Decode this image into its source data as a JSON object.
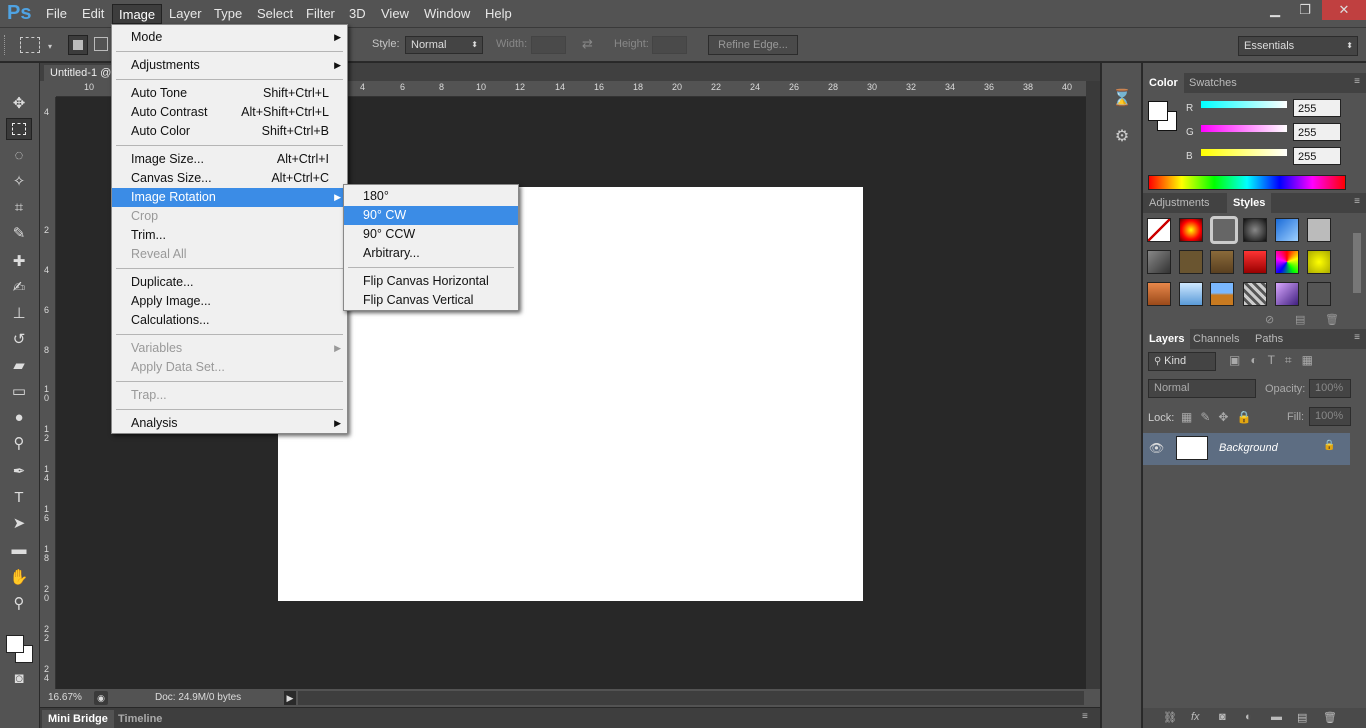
{
  "app": {
    "logo": "Ps"
  },
  "menubar": {
    "items": [
      "File",
      "Edit",
      "Image",
      "Layer",
      "Type",
      "Select",
      "Filter",
      "3D",
      "View",
      "Window",
      "Help"
    ]
  },
  "window_controls": {
    "minimize": "▁",
    "restore": "❐",
    "close": "✕"
  },
  "options_bar": {
    "style_label": "Style:",
    "style_value": "Normal",
    "width_label": "Width:",
    "height_label": "Height:",
    "refine_edge": "Refine Edge...",
    "workspace": "Essentials"
  },
  "document": {
    "tab": "Untitled-1 @",
    "zoom": "16.67%",
    "doc_info": "Doc: 24.9M/0 bytes"
  },
  "rulers": {
    "top_left": [
      "10"
    ],
    "top": [
      "4",
      "6",
      "8",
      "10",
      "12",
      "14",
      "16",
      "18",
      "20",
      "22",
      "24",
      "26",
      "28",
      "30",
      "32",
      "34",
      "36",
      "38",
      "40"
    ],
    "left": [
      "4",
      "2",
      "4",
      "6",
      "8",
      "10",
      "12",
      "14",
      "16",
      "18",
      "20",
      "22",
      "24"
    ]
  },
  "bottom_tabs": [
    "Mini Bridge",
    "Timeline"
  ],
  "image_menu": {
    "items": [
      {
        "label": "Mode",
        "arrow": true
      },
      {
        "sep": true
      },
      {
        "label": "Adjustments",
        "arrow": true
      },
      {
        "sep": true
      },
      {
        "label": "Auto Tone",
        "shortcut": "Shift+Ctrl+L"
      },
      {
        "label": "Auto Contrast",
        "shortcut": "Alt+Shift+Ctrl+L"
      },
      {
        "label": "Auto Color",
        "shortcut": "Shift+Ctrl+B"
      },
      {
        "sep": true
      },
      {
        "label": "Image Size...",
        "shortcut": "Alt+Ctrl+I"
      },
      {
        "label": "Canvas Size...",
        "shortcut": "Alt+Ctrl+C"
      },
      {
        "label": "Image Rotation",
        "arrow": true,
        "highlight": true
      },
      {
        "label": "Crop",
        "disabled": true
      },
      {
        "label": "Trim..."
      },
      {
        "label": "Reveal All",
        "disabled": true
      },
      {
        "sep": true
      },
      {
        "label": "Duplicate..."
      },
      {
        "label": "Apply Image..."
      },
      {
        "label": "Calculations..."
      },
      {
        "sep": true
      },
      {
        "label": "Variables",
        "arrow": true,
        "disabled": true
      },
      {
        "label": "Apply Data Set...",
        "disabled": true
      },
      {
        "sep": true
      },
      {
        "label": "Trap...",
        "disabled": true
      },
      {
        "sep": true
      },
      {
        "label": "Analysis",
        "arrow": true
      }
    ]
  },
  "rotation_submenu": {
    "items": [
      {
        "label": "180°"
      },
      {
        "label": "90° CW",
        "highlight": true
      },
      {
        "label": "90° CCW"
      },
      {
        "label": "Arbitrary..."
      },
      {
        "sep": true
      },
      {
        "label": "Flip Canvas Horizontal"
      },
      {
        "label": "Flip Canvas Vertical"
      }
    ]
  },
  "color_panel": {
    "tabs": [
      "Color",
      "Swatches"
    ],
    "channels": [
      {
        "label": "R",
        "value": "255"
      },
      {
        "label": "G",
        "value": "255"
      },
      {
        "label": "B",
        "value": "255"
      }
    ],
    "slider_colors": [
      "#00e5ff",
      "#ff00ff",
      "#ffff00"
    ]
  },
  "styles_panel": {
    "tabs": [
      "Adjustments",
      "Styles"
    ]
  },
  "layers_panel": {
    "tabs": [
      "Layers",
      "Channels",
      "Paths"
    ],
    "kind": "Kind",
    "blend": "Normal",
    "opacity_label": "Opacity:",
    "opacity": "100%",
    "lock_label": "Lock:",
    "fill_label": "Fill:",
    "fill": "100%",
    "layer_name": "Background"
  },
  "colors": {
    "accent": "#3b8ce6",
    "panel": "#535353",
    "workspace": "#282828",
    "logo": "#4fa3e3"
  }
}
